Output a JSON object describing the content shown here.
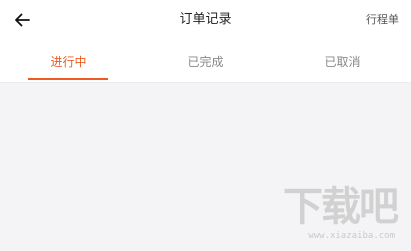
{
  "header": {
    "back_icon": "arrow-left-icon",
    "title": "订单记录",
    "right_link": "行程单"
  },
  "tabs": [
    {
      "label": "进行中",
      "active": true
    },
    {
      "label": "已完成",
      "active": false
    },
    {
      "label": "已取消",
      "active": false
    }
  ],
  "colors": {
    "accent": "#ee5a22",
    "background": "#f4f4f6",
    "header_bg": "#ffffff"
  },
  "watermark": {
    "main": "下载吧",
    "sub": "www.xiazaiba.com"
  }
}
